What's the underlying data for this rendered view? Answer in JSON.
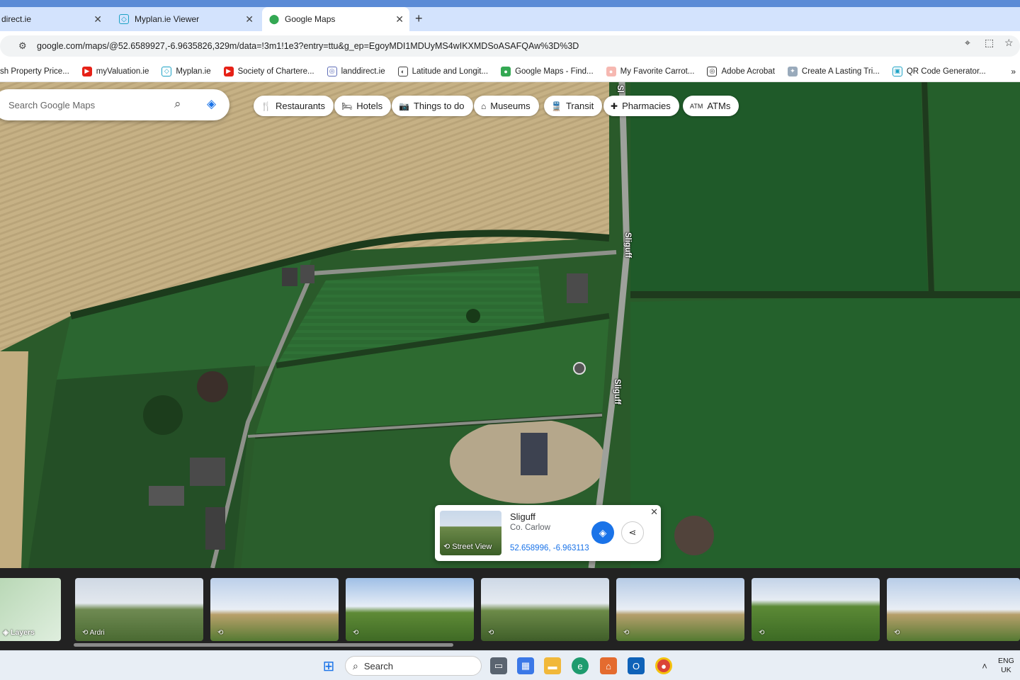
{
  "browser": {
    "tabs": [
      {
        "title": "direct.ie",
        "active": false
      },
      {
        "title": "Myplan.ie Viewer",
        "active": false
      },
      {
        "title": "Google Maps",
        "active": true
      }
    ],
    "new_tab": "+",
    "url": "google.com/maps/@52.6589927,-6.9635826,329m/data=!3m1!1e3?entry=ttu&g_ep=EgoyMDI1MDUyMS4wIKXMDSoASAFQAw%3D%3D",
    "bookmarks": [
      {
        "label": "sh Property Price..."
      },
      {
        "label": "myValuation.ie"
      },
      {
        "label": "Myplan.ie"
      },
      {
        "label": "Society of Chartere..."
      },
      {
        "label": "landdirect.ie"
      },
      {
        "label": "Latitude and Longit..."
      },
      {
        "label": "Google Maps - Find..."
      },
      {
        "label": "My Favorite Carrot..."
      },
      {
        "label": "Adobe Acrobat"
      },
      {
        "label": "Create A Lasting Tri..."
      },
      {
        "label": "QR Code Generator..."
      }
    ]
  },
  "maps": {
    "search_placeholder": "Search Google Maps",
    "categories": [
      "Restaurants",
      "Hotels",
      "Things to do",
      "Museums",
      "Transit",
      "Pharmacies",
      "ATMs"
    ],
    "road_labels": [
      "Sliguff",
      "Sliguff",
      "Sl"
    ],
    "place_card": {
      "title": "Sliguff",
      "subtitle": "Co. Carlow",
      "coordinates": "52.658996, -6.963113",
      "street_view_label": "Street View"
    },
    "photo_strip": {
      "layers_label": "Layers",
      "photos": [
        {
          "label": "Ardri"
        },
        {
          "label": ""
        },
        {
          "label": ""
        },
        {
          "label": ""
        },
        {
          "label": ""
        },
        {
          "label": ""
        },
        {
          "label": ""
        }
      ]
    }
  },
  "taskbar": {
    "search_label": "Search",
    "lang_top": "ENG",
    "lang_bottom": "UK"
  },
  "colors": {
    "accent_blue": "#1a73e8",
    "tabstrip": "#d3e3fd",
    "field_crop": "#c8b48a",
    "field_grass": "#2f6b30"
  }
}
